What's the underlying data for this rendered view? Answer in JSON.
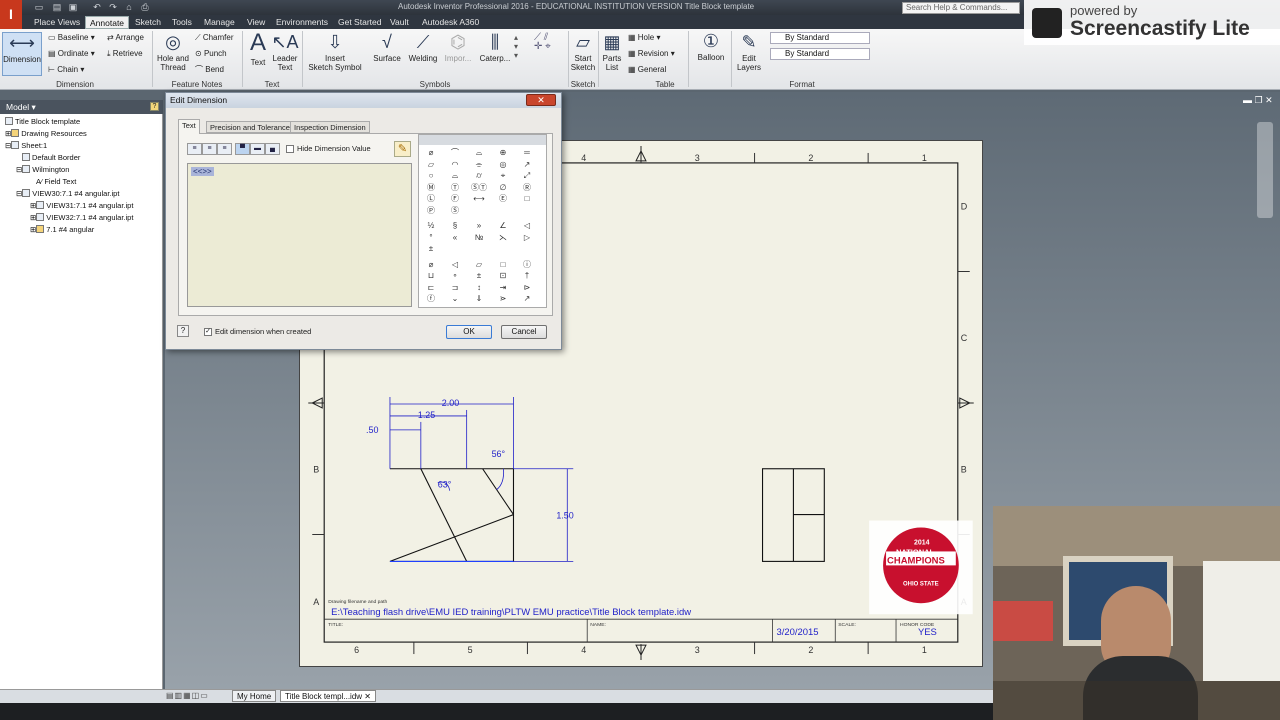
{
  "window": {
    "title": "Autodesk Inventor Professional 2016 - EDUCATIONAL INSTITUTION VERSION   Title Block template",
    "search_placeholder": "Search Help & Commands..."
  },
  "tabs": [
    "Place Views",
    "Annotate",
    "Sketch",
    "Tools",
    "Manage",
    "View",
    "Environments",
    "Get Started",
    "Vault",
    "Autodesk A360"
  ],
  "ribbon": {
    "dimension": "Dimension",
    "baseline": "Baseline",
    "ordinate": "Ordinate",
    "chain": "Chain",
    "arrange": "Arrange",
    "retrieve": "Retrieve",
    "hole_thread": "Hole and\nThread",
    "chamfer": "Chamfer",
    "punch": "Punch",
    "bend": "Bend",
    "text": "Text",
    "leader_text": "Leader\nText",
    "insert_sketch_symbol": "Insert\nSketch Symbol",
    "surface": "Surface",
    "welding": "Welding",
    "import": "Impor...",
    "caterpillar": "Caterp...",
    "start_sketch": "Start\nSketch",
    "parts_list": "Parts\nList",
    "hole": "Hole",
    "revision": "Revision",
    "general": "General",
    "balloon": "Balloon",
    "edit_layers": "Edit\nLayers",
    "by_standard_1": "By Standard",
    "by_standard_2": "By Standard",
    "groups": {
      "dimension": "Dimension",
      "feature_notes": "Feature Notes",
      "text": "Text",
      "symbols": "Symbols",
      "sketch": "Sketch",
      "table": "Table",
      "format": "Format"
    }
  },
  "browser": {
    "header": "Model ▾",
    "items": [
      {
        "label": "Title Block template",
        "indent": 0
      },
      {
        "label": "Drawing Resources",
        "indent": 1
      },
      {
        "label": "Sheet:1",
        "indent": 1
      },
      {
        "label": "Default Border",
        "indent": 2
      },
      {
        "label": "Wilmington",
        "indent": 2
      },
      {
        "label": "Field Text",
        "indent": 3
      },
      {
        "label": "VIEW30:7.1 #4 angular.ipt",
        "indent": 2
      },
      {
        "label": "VIEW31:7.1 #4 angular.ipt",
        "indent": 3
      },
      {
        "label": "VIEW32:7.1 #4 angular.ipt",
        "indent": 3
      },
      {
        "label": "7.1 #4 angular",
        "indent": 3
      }
    ]
  },
  "dialog": {
    "title": "Edit Dimension",
    "tabs": [
      "Text",
      "Precision and Tolerance",
      "Inspection Dimension"
    ],
    "hide_value": "Hide Dimension Value",
    "value_token": "<<>>",
    "edit_when_created": "Edit dimension when created",
    "ok": "OK",
    "cancel": "Cancel",
    "symbols": [
      "⌀",
      "⌒",
      "⌓",
      "⊕",
      "═",
      "▱",
      "◠",
      "⌯",
      "◎",
      "↗",
      "○",
      "⌓",
      "⌭",
      "⌖",
      "⤢",
      "Ⓜ",
      "Ⓣ",
      "ⓈⓉ",
      "∅",
      "Ⓡ",
      "Ⓛ",
      "Ⓕ",
      "⟷",
      "Ⓔ",
      "□",
      "Ⓟ",
      "Ⓢ",
      "",
      "",
      "",
      "½",
      "§",
      "»",
      "∠",
      "◁",
      "°",
      "«",
      "№",
      "⋋",
      "▷",
      "±",
      "",
      "",
      "",
      "",
      "⌀",
      "◁",
      "▱",
      "□",
      "ⓘ",
      "⊔",
      "∘",
      "±",
      "⊡",
      "†",
      "⊏",
      "⊐",
      "↕",
      "⇥",
      "⊳",
      "ⓕ",
      "⌄",
      "⇓",
      "⋗",
      "↗",
      "$",
      "◸",
      "◿",
      "",
      ""
    ]
  },
  "drawing": {
    "zones_top": [
      "4",
      "3",
      "2",
      "1"
    ],
    "zones_bottom": [
      "6",
      "5",
      "4",
      "3",
      "2",
      "1"
    ],
    "zones_right": [
      "D",
      "C",
      "B",
      "A"
    ],
    "zones_left": [
      "B",
      "A"
    ],
    "dims": {
      "d200": "2.00",
      "d125": "1.25",
      "d050": ".50",
      "a56": "56°",
      "a63": "63°",
      "d150": "1.50"
    },
    "title_block": {
      "path_label": "Drawing filename and path",
      "path": "E:\\Teaching flash drive\\EMU IED training\\PLTW EMU practice\\Title Block template.idw",
      "title_label": "TITLE:",
      "name_label": "NAME:",
      "date": "3/20/2015",
      "scale_label": "SCALE:",
      "honor_label": "HONOR CODE",
      "honor": "YES"
    },
    "logo": {
      "year": "2014",
      "line1": "NATIONAL",
      "line2": "CHAMPIONS",
      "line3": "OHIO STATE"
    }
  },
  "status": {
    "home_tab": "My Home",
    "doc_tab": "Title Block templ...idw"
  },
  "screencastify": {
    "line1": "powered by",
    "line2": "Screencastify Lite"
  },
  "colors": {
    "dim_blue": "#1f1fc8",
    "sheet": "#f2f1e5",
    "logo_red": "#c8102e"
  }
}
